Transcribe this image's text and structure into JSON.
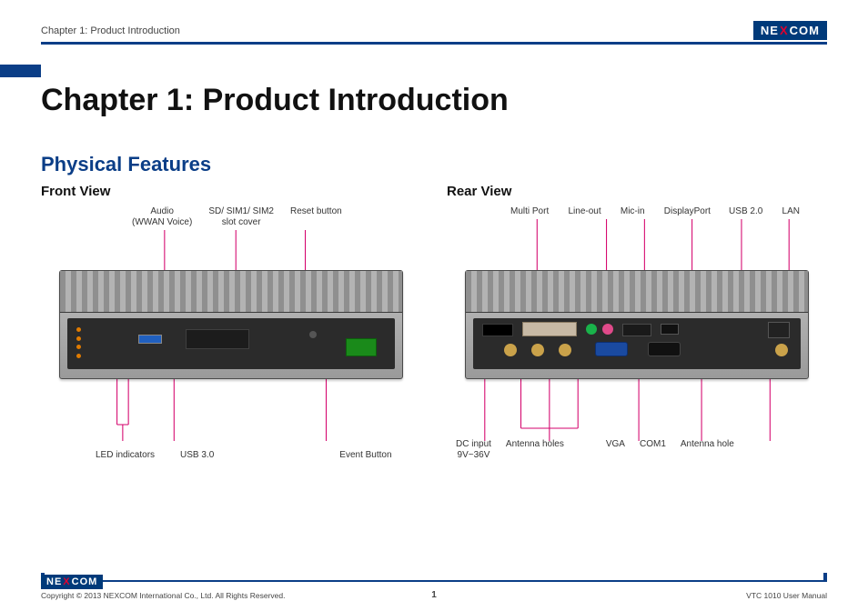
{
  "header": {
    "breadcrumb": "Chapter 1: Product Introduction",
    "brand": {
      "pre": "NE",
      "x": "X",
      "post": "COM"
    }
  },
  "title": "Chapter 1: Product Introduction",
  "section": "Physical Features",
  "front": {
    "heading": "Front View",
    "top_labels": [
      "Audio\n(WWAN Voice)",
      "SD/ SIM1/ SIM2\nslot cover",
      "Reset button"
    ],
    "bottom_labels": [
      "LED indicators",
      "USB 3.0",
      "Event Button"
    ]
  },
  "rear": {
    "heading": "Rear View",
    "top_labels": [
      "Multi Port",
      "Line-out",
      "Mic-in",
      "DisplayPort",
      "USB 2.0",
      "LAN"
    ],
    "bottom_labels": [
      "DC input\n9V~36V",
      "Antenna holes",
      "VGA",
      "COM1",
      "Antenna hole"
    ]
  },
  "footer": {
    "copyright": "Copyright © 2013 NEXCOM International Co., Ltd. All Rights Reserved.",
    "page": "1",
    "doc": "VTC 1010 User Manual",
    "brand": {
      "pre": "NE",
      "x": "X",
      "post": "COM"
    }
  }
}
